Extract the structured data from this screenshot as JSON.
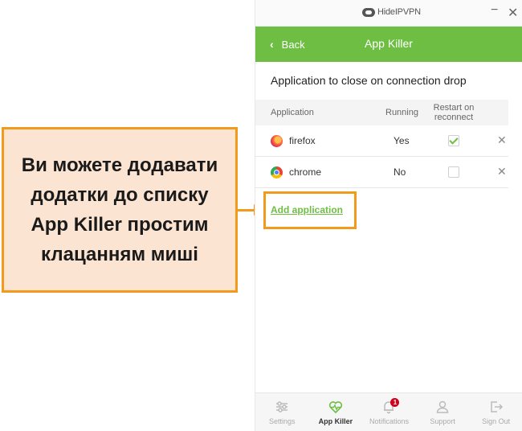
{
  "callout": {
    "text": "Ви можете додавати додатки до списку App Killer простим клацанням миші"
  },
  "window": {
    "brand": "HideIPVPN",
    "minimize": "−",
    "close": "✕"
  },
  "appbar": {
    "back_label": "Back",
    "back_icon": "chevron-left-icon",
    "title": "App Killer",
    "color": "#6ebe44"
  },
  "section": {
    "title": "Application to close on connection drop"
  },
  "table": {
    "headers": {
      "application": "Application",
      "running": "Running",
      "restart": "Restart on reconnect"
    },
    "rows": [
      {
        "name": "firefox",
        "icon": "firefox-icon",
        "running": "Yes",
        "restart_checked": true,
        "remove": "✕"
      },
      {
        "name": "chrome",
        "icon": "chrome-icon",
        "running": "No",
        "restart_checked": false,
        "remove": "✕"
      }
    ]
  },
  "add_link": "Add application",
  "nav": {
    "items": [
      {
        "label": "Settings",
        "icon": "sliders-icon",
        "active": false
      },
      {
        "label": "App Killer",
        "icon": "heart-pulse-icon",
        "active": true
      },
      {
        "label": "Notifications",
        "icon": "bell-icon",
        "active": false,
        "badge": "1"
      },
      {
        "label": "Support",
        "icon": "user-icon",
        "active": false
      },
      {
        "label": "Sign Out",
        "icon": "sign-out-icon",
        "active": false
      }
    ]
  },
  "colors": {
    "accent": "#6ebe44",
    "callout_border": "#f29a1b",
    "callout_bg": "#fbe5d2",
    "badge": "#d0021b"
  }
}
